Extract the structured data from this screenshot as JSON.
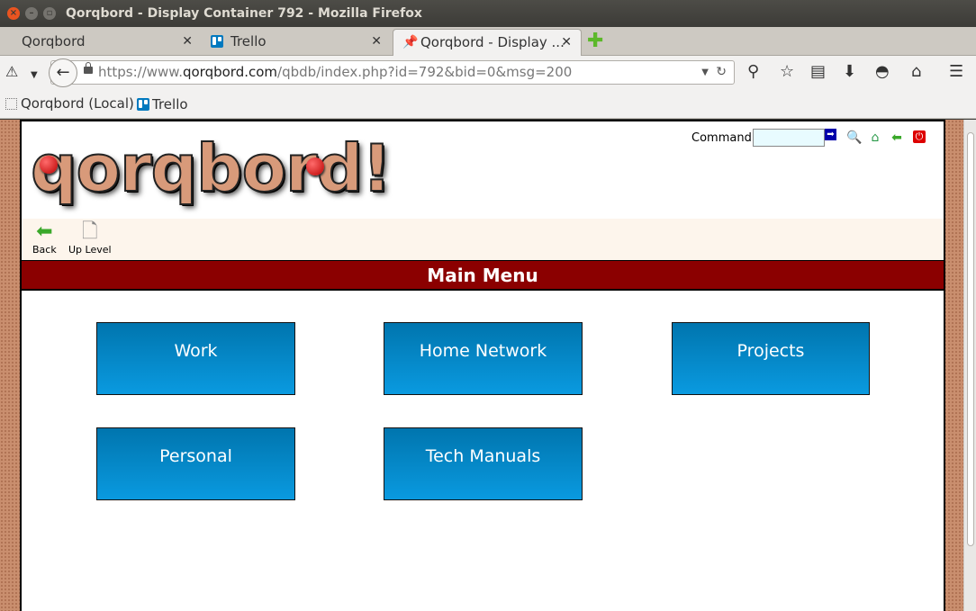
{
  "window": {
    "title": "Qorqbord - Display Container 792 - Mozilla Firefox"
  },
  "tabs": [
    {
      "label": "Qorqbord"
    },
    {
      "label": "Trello"
    },
    {
      "label": "Qorqbord - Display ..."
    }
  ],
  "navbar": {
    "url_prefix": "https://www.",
    "url_domain": "qorqbord.com",
    "url_path": "/qbdb/index.php?id=792&bid=0&msg=200"
  },
  "bookmarks": [
    {
      "label": "Qorqbord (Local)"
    },
    {
      "label": "Trello"
    }
  ],
  "page": {
    "logo_text": "qorqbord!",
    "command_label": "Command:",
    "command_value": "",
    "toolbar": {
      "back": "Back",
      "up_level": "Up Level"
    },
    "menu_title": "Main Menu",
    "tiles": [
      {
        "label": "Work"
      },
      {
        "label": "Home Network"
      },
      {
        "label": "Projects"
      },
      {
        "label": "Personal"
      },
      {
        "label": "Tech Manuals"
      }
    ]
  },
  "colors": {
    "menu_bar": "#8b0000",
    "tile": "#0a8fd0",
    "cork": "#c98e6e"
  }
}
